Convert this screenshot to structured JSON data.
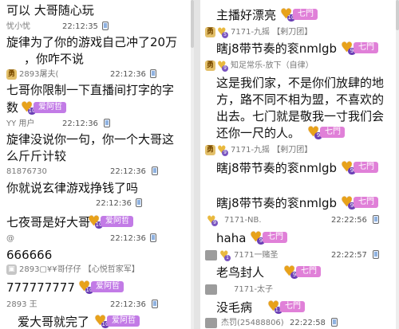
{
  "left": {
    "messages": [
      {
        "id": "m1",
        "text": "可以 大哥随心玩"
      },
      {
        "id": "m2",
        "text": "旋律为了你的游戏自己冲了20万"
      },
      {
        "id": "m2b",
        "text": "，你咋不说"
      },
      {
        "id": "m3",
        "text": "七哥你限制一下直播间打字的字"
      },
      {
        "id": "m3b",
        "text": "数"
      },
      {
        "id": "m4",
        "text": "旋律没说你一句，你一个大哥这"
      },
      {
        "id": "m4b",
        "text": "么斤斤计较"
      },
      {
        "id": "m5",
        "text": "你就说玄律游戏挣钱了吗"
      },
      {
        "id": "m6",
        "text": "七夜哥是好大哥"
      },
      {
        "id": "m7",
        "text": "666666"
      },
      {
        "id": "m8",
        "text": "777777777"
      },
      {
        "id": "m9",
        "text": "爱大哥就完了"
      }
    ],
    "meta": [
      {
        "id": "u1",
        "user": "忧小忧",
        "time": "22:12:35"
      },
      {
        "id": "u2",
        "user": "2893屠夫(",
        "time": "22:12:36"
      },
      {
        "id": "u3",
        "user": "YY 用户",
        "time": "22:12:36"
      },
      {
        "id": "u4",
        "user": "81876730",
        "time": "22:12:36"
      },
      {
        "id": "u5",
        "user": "",
        "time": "22:12:36"
      },
      {
        "id": "u6",
        "user": "@",
        "time": "22:12:36"
      },
      {
        "id": "u7",
        "user": "2893▢¥¥哥仔仔 【心悦哲家军】",
        "time": ""
      },
      {
        "id": "u8",
        "user": "2893 王",
        "time": "22:12:36"
      }
    ],
    "badges": [
      {
        "id": "b1",
        "label": "爱阿哲",
        "level": "10"
      },
      {
        "id": "b2",
        "label": "爱阿哲",
        "level": "10"
      },
      {
        "id": "b3",
        "label": "爱阿哲",
        "level": "10"
      },
      {
        "id": "b4",
        "label": "爱阿哲",
        "level": "10"
      }
    ],
    "topline": "22:12:35"
  },
  "right": {
    "messages": [
      {
        "id": "r1",
        "text": "主播好漂亮"
      },
      {
        "id": "r2",
        "text": "瞎j8带节奏的衮nmlgb"
      },
      {
        "id": "r3",
        "text": "这是我们家，不是你们放肆的地"
      },
      {
        "id": "r3b",
        "text": "方，路不同不相为盟，不喜欢的"
      },
      {
        "id": "r3c",
        "text": "出去。七门就是敬我一寸我们会"
      },
      {
        "id": "r3d",
        "text": "还你一尺的人。"
      },
      {
        "id": "r4",
        "text": "瞎j8带节奏的衮nmlgb"
      },
      {
        "id": "r5",
        "text": "瞎j8带节奏的衮nmlgb"
      },
      {
        "id": "r6",
        "text": "haha"
      },
      {
        "id": "r7",
        "text": "老鸟封人"
      },
      {
        "id": "r8",
        "text": "没毛病"
      }
    ],
    "meta": [
      {
        "id": "s1",
        "user": "7171-九摇 【剌刀团】",
        "time": ""
      },
      {
        "id": "s2",
        "user": "知足常乐-放下（自律）",
        "time": ""
      },
      {
        "id": "s3",
        "user": "7171-九摇 【剌刀团】",
        "time": ""
      },
      {
        "id": "s4",
        "user": "7171-NB.",
        "time": "22:22:56"
      },
      {
        "id": "s5",
        "user": "7171一赌圣",
        "time": "22:22:57"
      },
      {
        "id": "s6",
        "user": "7171-太子",
        "time": "22:22:58"
      },
      {
        "id": "s7",
        "user": "杰罚(25488806)",
        "time": "22:22:58"
      }
    ],
    "badges": [
      {
        "id": "c1",
        "label": "七門",
        "level": "10"
      },
      {
        "id": "c2",
        "label": "七門",
        "level": "9"
      },
      {
        "id": "c3",
        "label": "七門",
        "level": "9"
      },
      {
        "id": "c4",
        "label": "七門",
        "level": "9"
      },
      {
        "id": "c5",
        "label": "七門",
        "level": "9"
      },
      {
        "id": "c6",
        "label": "七門",
        "level": "9"
      },
      {
        "id": "c7",
        "label": "七門",
        "level": "9"
      },
      {
        "id": "c8",
        "label": "七門",
        "level": "13"
      }
    ],
    "small_levels": [
      "5",
      "9",
      "9",
      "9",
      "1"
    ]
  },
  "colors": {
    "badge_purple": "#c27be6",
    "badge_pink": "#e080d8",
    "heart_gold": "#e8a21a",
    "level_gold": "#d8b24a"
  }
}
